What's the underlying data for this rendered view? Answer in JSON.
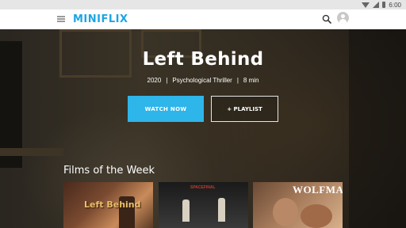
{
  "status_bar": {
    "time": "6:00"
  },
  "app": {
    "logo": "MINIFLIX"
  },
  "icons": {
    "menu": "menu-icon",
    "search": "search-icon",
    "avatar": "account-icon"
  },
  "colors": {
    "brand": "#1aa6e5",
    "watch_button": "#2eb5ea"
  },
  "hero": {
    "title": "Left Behind",
    "year": "2020",
    "genre": "Psychological Thriller",
    "duration": "8 min",
    "separator": "|",
    "watch_label": "WATCH NOW",
    "playlist_label": "+ PLAYLIST"
  },
  "films_of_week": {
    "heading": "Films of the Week",
    "items": [
      {
        "title_art": "Left Behind"
      },
      {
        "title_art": "SPACEFINAL"
      },
      {
        "title_art": "WOLFMAN"
      }
    ]
  }
}
